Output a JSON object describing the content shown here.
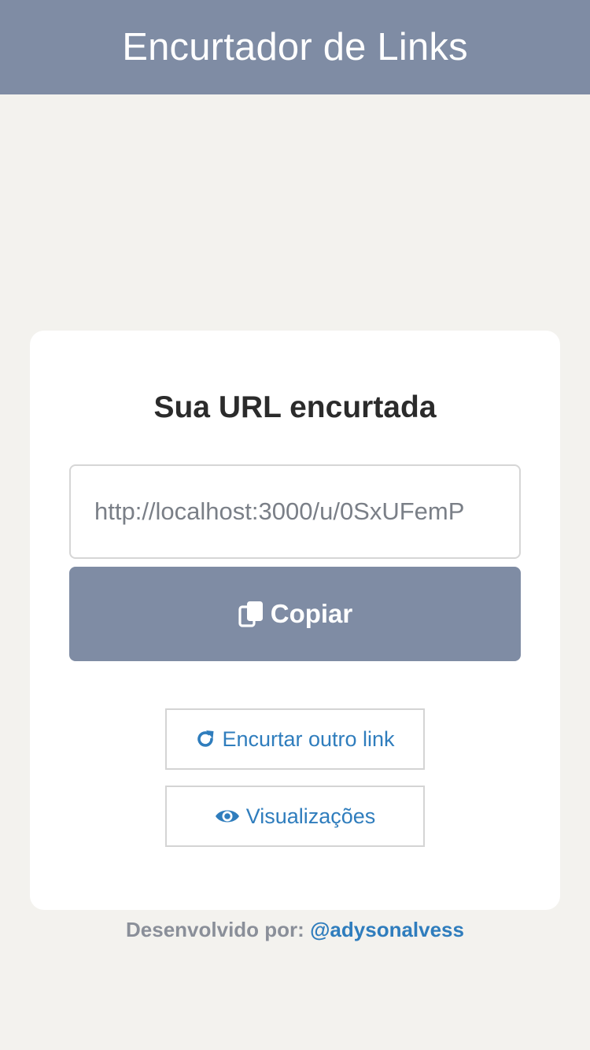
{
  "header": {
    "title": "Encurtador de Links"
  },
  "card": {
    "title": "Sua URL encurtada",
    "short_url": "http://localhost:3000/u/0SxUFemP",
    "copy_button": {
      "label": "Copiar",
      "icon": "copy-icon"
    },
    "shorten_another_button": {
      "label": "Encurtar outro link",
      "icon": "refresh-icon"
    },
    "views_button": {
      "label": "Visualizações",
      "icon": "eye-icon"
    }
  },
  "footer": {
    "label": "Desenvolvido por:",
    "handle": "@adysonalvess"
  },
  "colors": {
    "header_bg": "#7f8ca4",
    "page_bg": "#f3f2ee",
    "accent_link": "#2f7dbd"
  }
}
